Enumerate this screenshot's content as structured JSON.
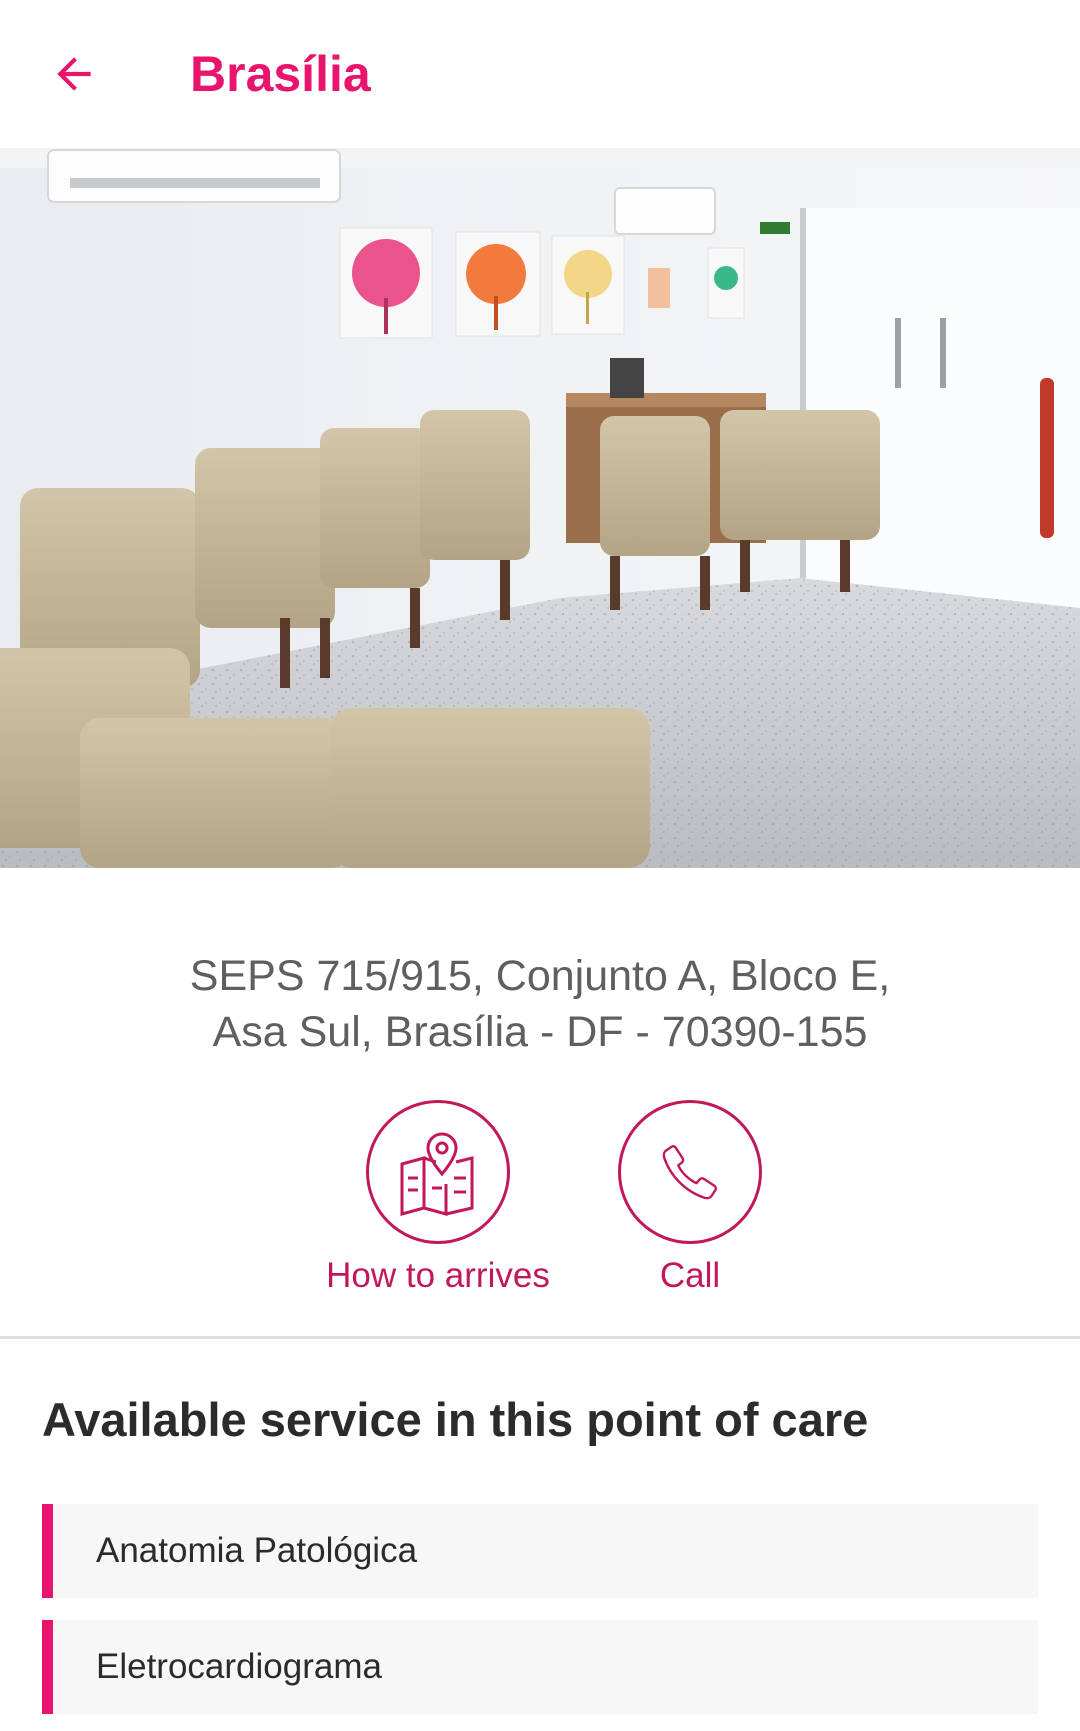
{
  "header": {
    "title": "Brasília",
    "back_icon": "arrow-left-icon",
    "accent_color": "#e8146e"
  },
  "photo": {
    "description_icon": "waiting-room-photo"
  },
  "location": {
    "address_line1": "SEPS 715/915, Conjunto A, Bloco E,",
    "address_line2": "Asa Sul, Brasília - DF - 70390-155"
  },
  "actions": {
    "route": {
      "label": "How to arrives",
      "icon": "map-pin-icon"
    },
    "call": {
      "label": "Call",
      "icon": "phone-icon"
    },
    "color": "#c2185b"
  },
  "services": {
    "title": "Available service in this point of care",
    "items": [
      {
        "label": "Anatomia Patológica"
      },
      {
        "label": "Eletrocardiograma"
      }
    ]
  }
}
